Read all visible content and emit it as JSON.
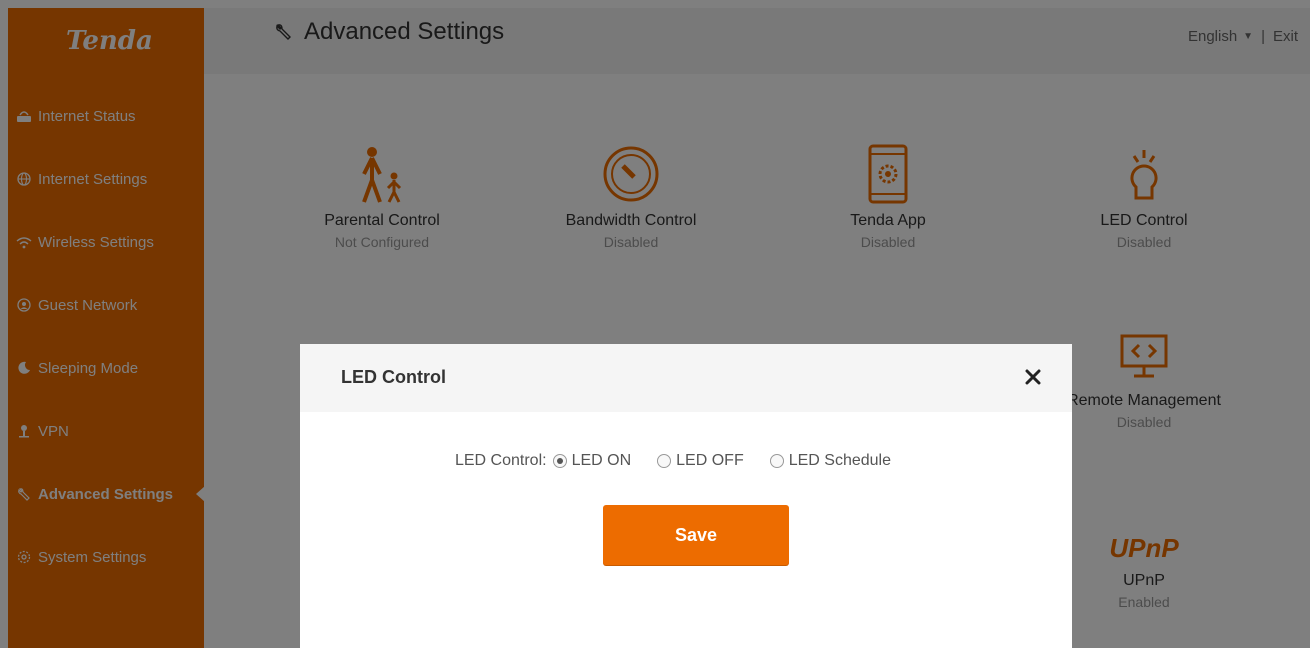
{
  "brand": {
    "logo_text": "Tenda",
    "accent_color": "#ed6c00"
  },
  "sidebar": {
    "items": [
      {
        "label": "Internet Status",
        "icon": "router-icon"
      },
      {
        "label": "Internet Settings",
        "icon": "globe-icon"
      },
      {
        "label": "Wireless Settings",
        "icon": "wifi-icon"
      },
      {
        "label": "Guest Network",
        "icon": "guest-icon"
      },
      {
        "label": "Sleeping Mode",
        "icon": "moon-icon"
      },
      {
        "label": "VPN",
        "icon": "vpn-icon"
      },
      {
        "label": "Advanced Settings",
        "icon": "wrench-icon",
        "active": true
      },
      {
        "label": "System Settings",
        "icon": "gear-icon"
      }
    ]
  },
  "header": {
    "title": "Advanced Settings",
    "language": "English",
    "separator": "|",
    "exit_label": "Exit"
  },
  "tiles": [
    {
      "name": "Parental Control",
      "status": "Not Configured",
      "icon": "parent-child-icon"
    },
    {
      "name": "Bandwidth Control",
      "status": "Disabled",
      "icon": "speedometer-icon"
    },
    {
      "name": "Tenda App",
      "status": "Disabled",
      "icon": "tablet-gear-icon"
    },
    {
      "name": "LED Control",
      "status": "Disabled",
      "icon": "bulb-icon"
    },
    {
      "name": "Remote Management",
      "status": "Disabled",
      "icon": "monitor-code-icon"
    },
    {
      "name": "UPnP",
      "status": "Enabled",
      "icon": "upnp-icon",
      "icon_text": "UPnP"
    }
  ],
  "modal": {
    "title": "LED Control",
    "field_label": "LED Control:",
    "options": [
      {
        "label": "LED ON",
        "selected": true
      },
      {
        "label": "LED OFF",
        "selected": false
      },
      {
        "label": "LED Schedule",
        "selected": false
      }
    ],
    "save_label": "Save"
  }
}
